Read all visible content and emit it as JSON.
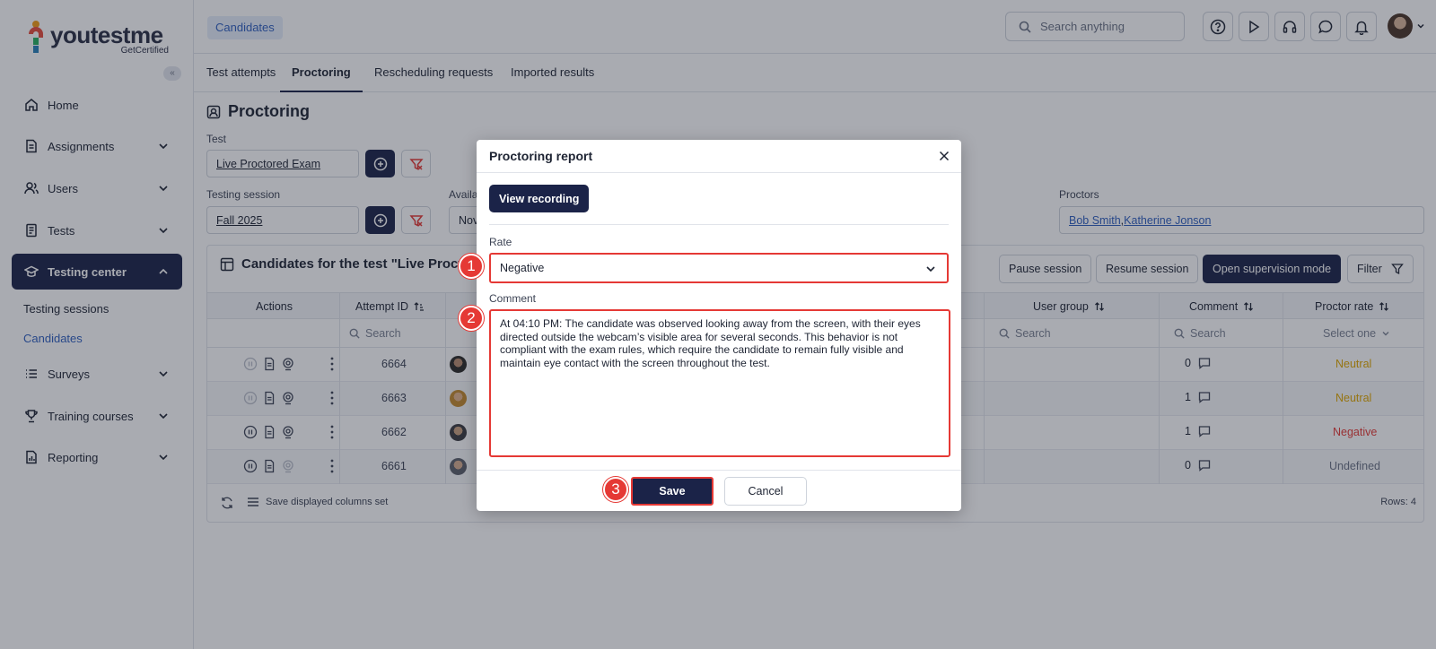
{
  "brand": {
    "name_a": "youtest",
    "name_b": "me",
    "sub": "GetCertified",
    "collapse_glyph": "«"
  },
  "sidebar": {
    "items": [
      {
        "label": "Home",
        "icon": "home-icon"
      },
      {
        "label": "Assignments",
        "icon": "document-icon"
      },
      {
        "label": "Users",
        "icon": "users-icon"
      },
      {
        "label": "Tests",
        "icon": "test-icon"
      },
      {
        "label": "Testing center",
        "icon": "graduation-cap-icon",
        "active": true
      },
      {
        "label": "Surveys",
        "icon": "list-icon"
      },
      {
        "label": "Training courses",
        "icon": "trophy-icon"
      },
      {
        "label": "Reporting",
        "icon": "report-icon"
      }
    ],
    "sub_items": [
      {
        "label": "Testing sessions"
      },
      {
        "label": "Candidates",
        "active": true
      }
    ]
  },
  "header": {
    "breadcrumb": "Candidates",
    "search_placeholder": "Search anything",
    "icons": [
      "help-icon",
      "play-icon",
      "headset-icon",
      "chat-icon",
      "bell-icon"
    ]
  },
  "tabs": [
    {
      "label": "Test attempts"
    },
    {
      "label": "Proctoring",
      "active": true
    },
    {
      "label": "Rescheduling requests"
    },
    {
      "label": "Imported results"
    }
  ],
  "page": {
    "title": "Proctoring",
    "test_label": "Test",
    "test_value": "Live Proctored Exam",
    "session_label": "Testing session",
    "session_value": "Fall 2025",
    "avail_label": "Availa",
    "avail_value": "Nov",
    "proctors_label": "Proctors",
    "proctors": [
      "Bob Smith",
      "Katherine Jonson"
    ],
    "proctors_sep": ", "
  },
  "candidates": {
    "title": "Candidates for the test \"Live Proctored",
    "buttons": {
      "pause": "Pause session",
      "resume": "Resume session",
      "supervise": "Open supervision mode",
      "filter": "Filter"
    },
    "columns": {
      "actions": "Actions",
      "attempt_id": "Attempt ID",
      "user_group": "User group",
      "comment": "Comment",
      "proctor_rate": "Proctor rate"
    },
    "search_placeholder": "Search",
    "select_one": "Select one",
    "rows": [
      {
        "attempt_id": "6664",
        "comments": "0",
        "rate": "Neutral",
        "rate_color": "#e0a800"
      },
      {
        "attempt_id": "6663",
        "comments": "1",
        "rate": "Neutral",
        "rate_color": "#e0a800"
      },
      {
        "attempt_id": "6662",
        "comments": "1",
        "rate": "Negative",
        "rate_color": "#e53935"
      },
      {
        "attempt_id": "6661",
        "comments": "0",
        "rate": "Undefined",
        "rate_color": "#6b7385"
      }
    ],
    "footer": {
      "save_columns": "Save displayed columns set",
      "rows_count": "Rows: 4"
    }
  },
  "modal": {
    "title": "Proctoring report",
    "view_recording": "View recording",
    "rate_label": "Rate",
    "rate_value": "Negative",
    "comment_label": "Comment",
    "comment_value": "At 04:10 PM: The candidate was observed looking away from the screen, with their eyes directed outside the webcam’s visible area for several seconds. This behavior is not compliant with the exam rules, which require the candidate to remain fully visible and maintain eye contact with the screen throughout the test.",
    "save": "Save",
    "cancel": "Cancel",
    "steps": [
      "1",
      "2",
      "3"
    ]
  },
  "colors": {
    "navy": "#1b2348",
    "accent_blue": "#2f5fbf",
    "highlight_red": "#e53935",
    "neutral": "#e0a800"
  }
}
